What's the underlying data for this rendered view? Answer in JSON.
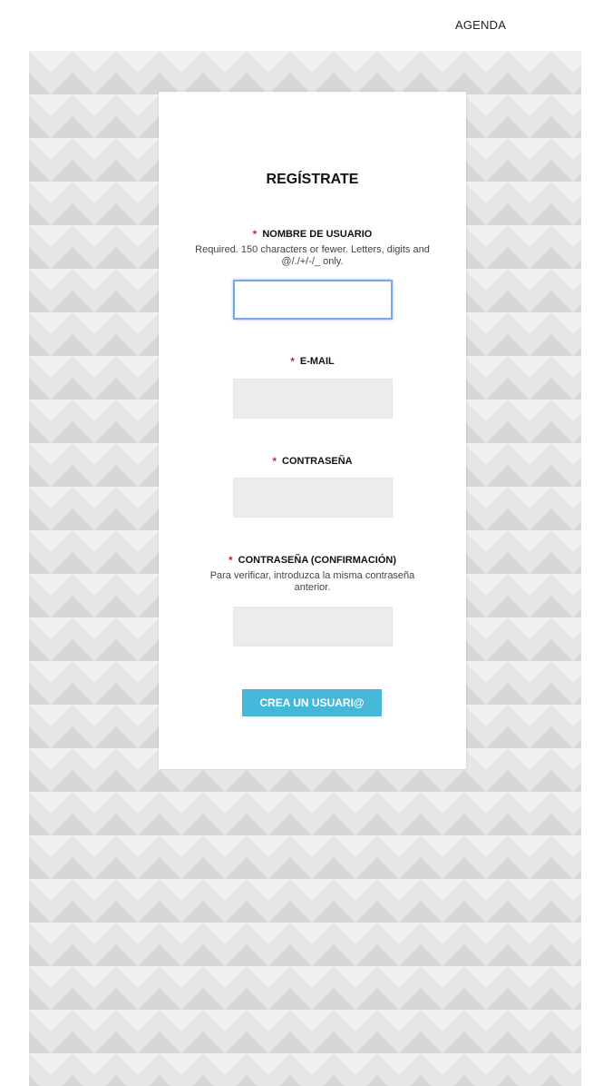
{
  "nav": {
    "agenda": "AGENDA"
  },
  "form": {
    "title": "REGÍSTRATE",
    "required_mark": "*",
    "username": {
      "label": "NOMBRE DE USUARIO",
      "help_1": "Required. 150 characters or fewer. Letters, digits and",
      "help_2": "@/./+/-/_ only.",
      "value": ""
    },
    "email": {
      "label": "E-MAIL",
      "value": ""
    },
    "password": {
      "label": "CONTRASEÑA",
      "value": ""
    },
    "password_confirm": {
      "label": "CONTRASEÑA (CONFIRMACIÓN)",
      "help_1": "Para verificar, introduzca la misma contraseña",
      "help_2": "anterior.",
      "value": ""
    },
    "submit_label": "CREA UN USUARI@"
  },
  "colors": {
    "accent": "#45b7d9",
    "required": "#e01b24",
    "focus_border": "#7aa7e6"
  }
}
